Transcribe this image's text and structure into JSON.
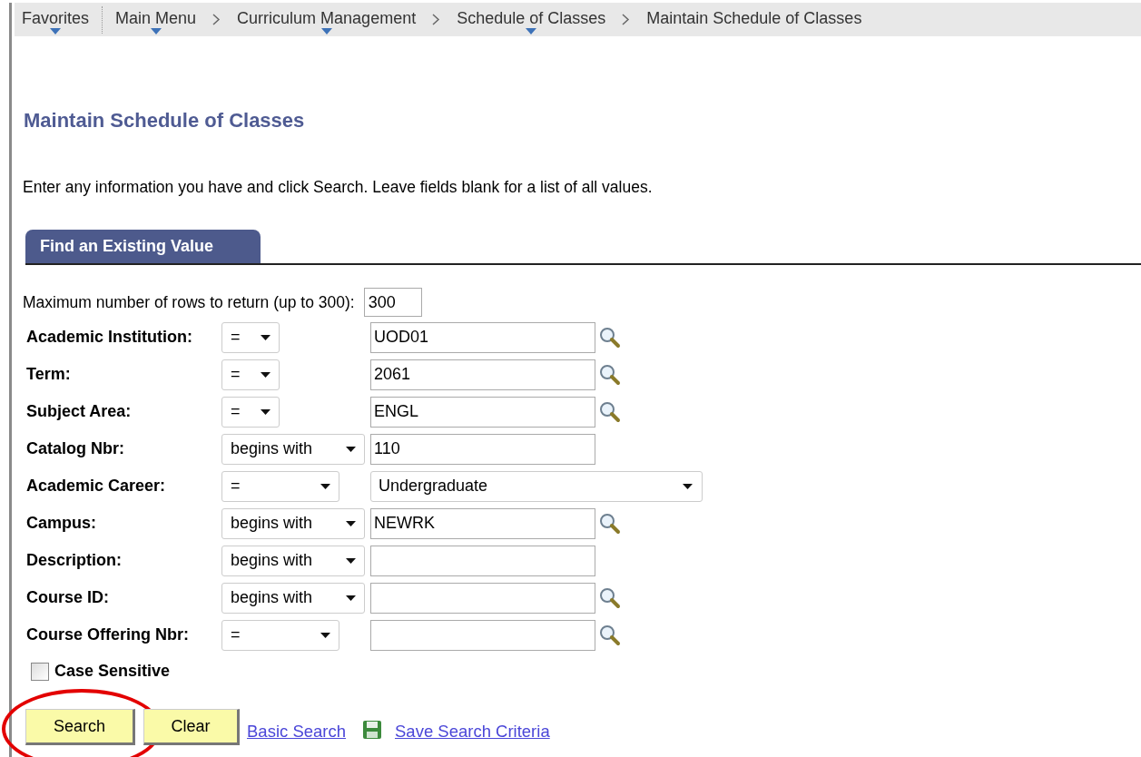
{
  "breadcrumb": [
    {
      "label": "Favorites",
      "has_menu": true
    },
    {
      "label": "Main Menu",
      "has_menu": true
    },
    {
      "label": "Curriculum Management",
      "has_menu": true
    },
    {
      "label": "Schedule of Classes",
      "has_menu": true
    },
    {
      "label": "Maintain Schedule of Classes",
      "has_menu": false
    }
  ],
  "title": "Maintain Schedule of Classes",
  "instructions": "Enter any information you have and click Search. Leave fields blank for a list of all values.",
  "tabs": [
    {
      "label": "Find an Existing Value",
      "selected": true
    }
  ],
  "max_rows": {
    "label": "Maximum number of rows to return (up to 300):",
    "value": "300"
  },
  "criteria": [
    {
      "label": "Academic Institution:",
      "operator": "=",
      "kind": "lookup",
      "value": "UOD01"
    },
    {
      "label": "Term:",
      "operator": "=",
      "kind": "lookup",
      "value": "2061"
    },
    {
      "label": "Subject Area:",
      "operator": "=",
      "kind": "lookup",
      "value": "ENGL"
    },
    {
      "label": "Catalog Nbr:",
      "operator": "begins with",
      "kind": "text",
      "value": "110"
    },
    {
      "label": "Academic Career:",
      "operator": "=",
      "kind": "dropdown",
      "value": "Undergraduate"
    },
    {
      "label": "Campus:",
      "operator": "begins with",
      "kind": "lookup",
      "value": "NEWRK"
    },
    {
      "label": "Description:",
      "operator": "begins with",
      "kind": "text"
    },
    {
      "label": "Course ID:",
      "operator": "begins with",
      "kind": "lookup"
    },
    {
      "label": "Course Offering Nbr:",
      "operator": "=",
      "kind": "lookup"
    }
  ],
  "case_sensitive": {
    "label": "Case Sensitive",
    "checked": false
  },
  "buttons": [
    {
      "label": "Search",
      "highlighted": true
    },
    {
      "label": "Clear",
      "highlighted": false
    }
  ],
  "links": [
    {
      "label": "Basic Search",
      "kind": "plain"
    },
    {
      "label": "Save Search Criteria",
      "kind": "save"
    }
  ]
}
